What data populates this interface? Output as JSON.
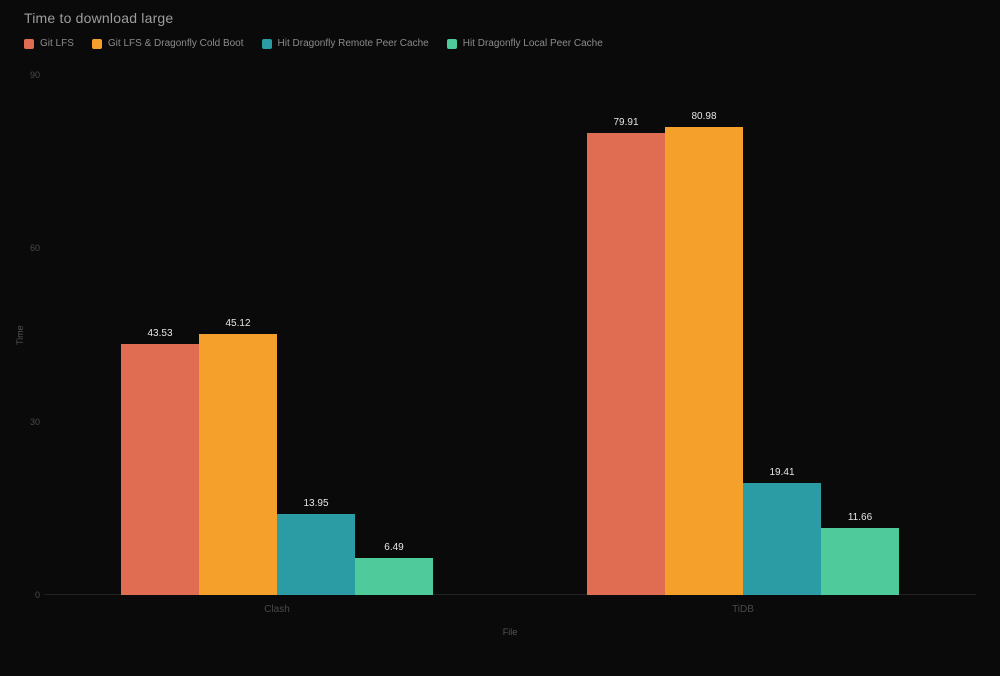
{
  "chart_data": {
    "type": "bar",
    "title": "Time to download large",
    "xlabel": "File",
    "ylabel": "Time",
    "ylim": [
      0,
      90
    ],
    "yticks": [
      0,
      30,
      60,
      90
    ],
    "categories": [
      "Clash",
      "TiDB"
    ],
    "series": [
      {
        "name": "Git LFS",
        "values": [
          43.53,
          79.91
        ],
        "color": "#e06c52"
      },
      {
        "name": "Git LFS & Dragonfly Cold Boot",
        "values": [
          45.12,
          80.98
        ],
        "color": "#f5a02a"
      },
      {
        "name": "Hit Dragonfly Remote Peer Cache",
        "values": [
          13.95,
          19.41
        ],
        "color": "#2b9ca3"
      },
      {
        "name": "Hit Dragonfly Local Peer Cache",
        "values": [
          6.49,
          11.66
        ],
        "color": "#4fcb9b"
      }
    ]
  }
}
